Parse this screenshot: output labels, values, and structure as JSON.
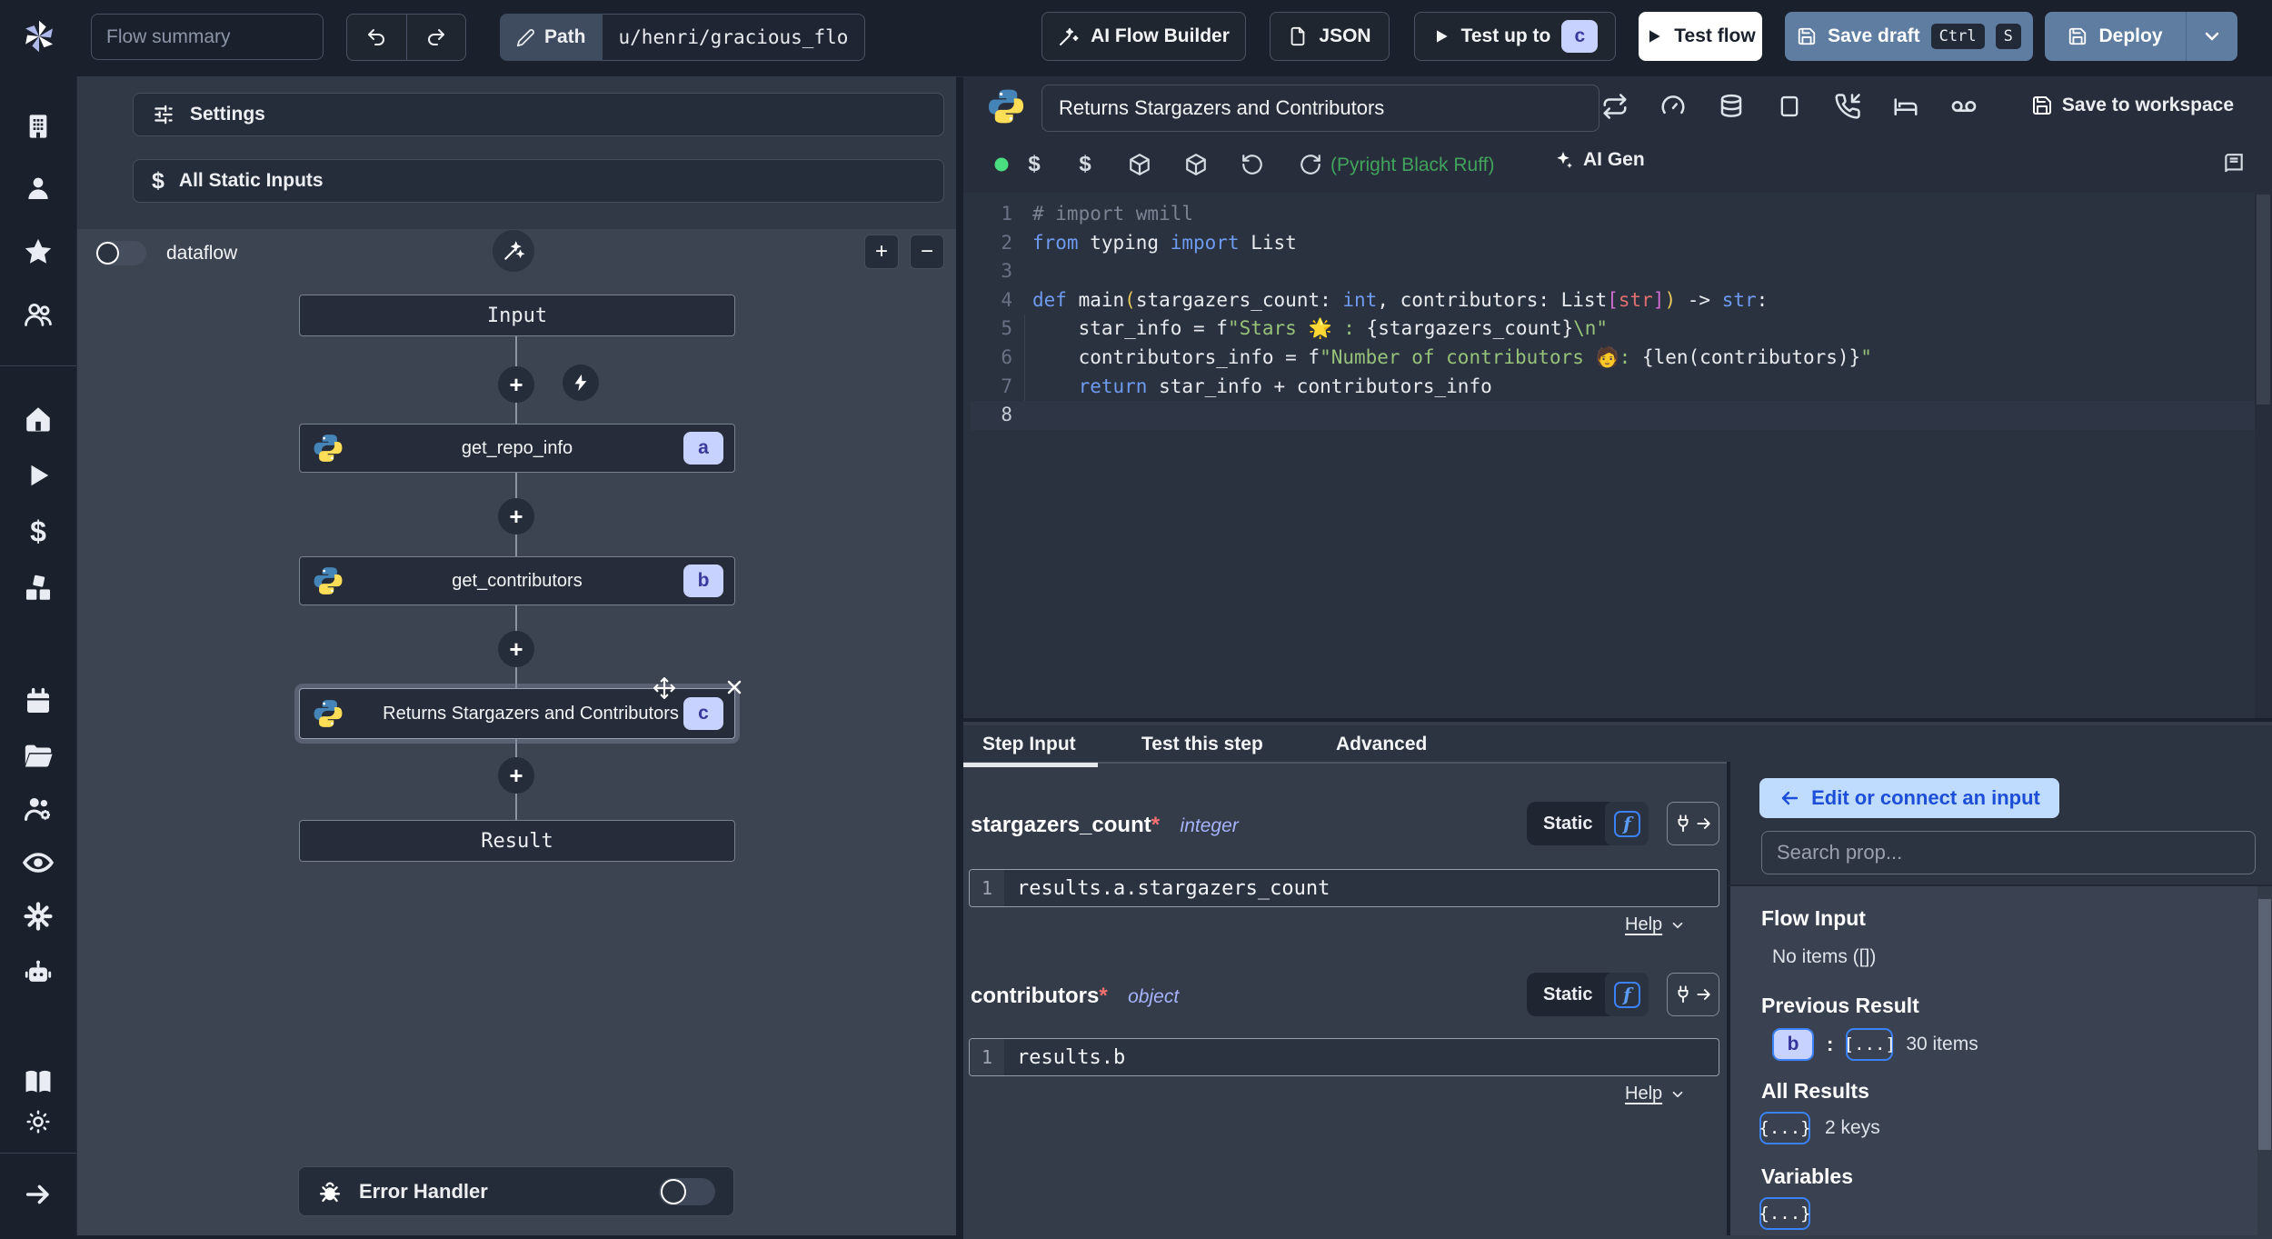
{
  "topbar": {
    "flow_summary_placeholder": "Flow summary",
    "path_label": "Path",
    "path_value": "u/henri/gracious_flow",
    "ai_flow_builder_label": "AI Flow Builder",
    "json_label": "JSON",
    "test_up_to_label": "Test up to",
    "test_up_to_badge": "c",
    "test_flow_label": "Test flow",
    "save_draft_label": "Save draft",
    "save_draft_kbd_1": "Ctrl",
    "save_draft_kbd_2": "S",
    "deploy_label": "Deploy"
  },
  "flow_panel": {
    "settings_label": "Settings",
    "all_static_inputs_label": "All Static Inputs",
    "dataflow_label": "dataflow",
    "zoom_in_label": "+",
    "zoom_out_label": "−",
    "nodes": {
      "input": {
        "label": "Input"
      },
      "a": {
        "label": "get_repo_info",
        "badge": "a"
      },
      "b": {
        "label": "get_contributors",
        "badge": "b"
      },
      "c": {
        "label": "Returns Stargazers and Contributors",
        "badge": "c"
      },
      "result": {
        "label": "Result"
      }
    },
    "error_handler_label": "Error Handler"
  },
  "editor": {
    "title_value": "Returns Stargazers and Contributors",
    "save_to_workspace_label": "Save to workspace",
    "lint_label": "(Pyright Black Ruff)",
    "ai_gen_label": "AI Gen",
    "code": {
      "line_numbers": [
        "1",
        "2",
        "3",
        "4",
        "5",
        "6",
        "7",
        "8"
      ],
      "lines": [
        [
          {
            "c": "cmt",
            "t": "# import wmill"
          }
        ],
        [
          {
            "c": "kw",
            "t": "from"
          },
          {
            "c": "pl",
            "t": " typing "
          },
          {
            "c": "kw",
            "t": "import"
          },
          {
            "c": "pl",
            "t": " List"
          }
        ],
        [],
        [
          {
            "c": "kw",
            "t": "def"
          },
          {
            "c": "fn",
            "t": " main"
          },
          {
            "c": "b1",
            "t": "("
          },
          {
            "c": "pl",
            "t": "stargazers_count: "
          },
          {
            "c": "kw",
            "t": "int"
          },
          {
            "c": "pl",
            "t": ", contributors: List"
          },
          {
            "c": "b2",
            "t": "["
          },
          {
            "c": "ty",
            "t": "str"
          },
          {
            "c": "b2",
            "t": "]"
          },
          {
            "c": "b1",
            "t": ")"
          },
          {
            "c": "pl",
            "t": " -> "
          },
          {
            "c": "kw",
            "t": "str"
          },
          {
            "c": "pl",
            "t": ":"
          }
        ],
        [
          {
            "c": "pl",
            "t": "    star_info = f"
          },
          {
            "c": "str",
            "t": "\"Stars "
          },
          {
            "c": "emj",
            "t": "🌟"
          },
          {
            "c": "str",
            "t": " : "
          },
          {
            "c": "pl",
            "t": "{stargazers_count}"
          },
          {
            "c": "str",
            "t": "\\n\""
          }
        ],
        [
          {
            "c": "pl",
            "t": "    contributors_info = f"
          },
          {
            "c": "str",
            "t": "\"Number of contributors "
          },
          {
            "c": "emj",
            "t": "🧑"
          },
          {
            "c": "str",
            "t": ": "
          },
          {
            "c": "pl",
            "t": "{len(contributors)}"
          },
          {
            "c": "str",
            "t": "\""
          }
        ],
        [
          {
            "c": "pl",
            "t": "    "
          },
          {
            "c": "kw",
            "t": "return"
          },
          {
            "c": "pl",
            "t": " star_info + contributors_info"
          }
        ],
        []
      ]
    }
  },
  "step_panel": {
    "tabs": [
      {
        "label": "Step Input"
      },
      {
        "label": "Test this step"
      },
      {
        "label": "Advanced"
      }
    ],
    "fields": [
      {
        "name": "stargazers_count",
        "required": "*",
        "type": "integer",
        "mode": "Static",
        "line_no": "1",
        "expr": "results.a.stargazers_count",
        "help_label": "Help"
      },
      {
        "name": "contributors",
        "required": "*",
        "type": "object",
        "mode": "Static",
        "line_no": "1",
        "expr": "results.b",
        "help_label": "Help"
      }
    ]
  },
  "props_panel": {
    "edit_connect_label": "Edit or connect an input",
    "search_placeholder": "Search prop...",
    "flow_input_title": "Flow Input",
    "flow_input_empty": "No items ([])",
    "previous_result_title": "Previous Result",
    "previous_result_key": "b",
    "previous_result_colon": ":",
    "previous_result_preview": "[...]",
    "previous_result_count": "30 items",
    "all_results_title": "All Results",
    "all_results_preview": "{...}",
    "all_results_count": "2 keys",
    "variables_title": "Variables",
    "variables_preview": "{...}"
  },
  "colors": {
    "accent_lavender": "#c7d2fe",
    "accent_blue": "#3b82f6",
    "slate_button": "#5e7da1",
    "edit_connect_bg": "#bfdbfe",
    "edit_connect_text": "#1d4ed8",
    "lint_green": "#41a35c",
    "status_green": "#4ade80"
  }
}
